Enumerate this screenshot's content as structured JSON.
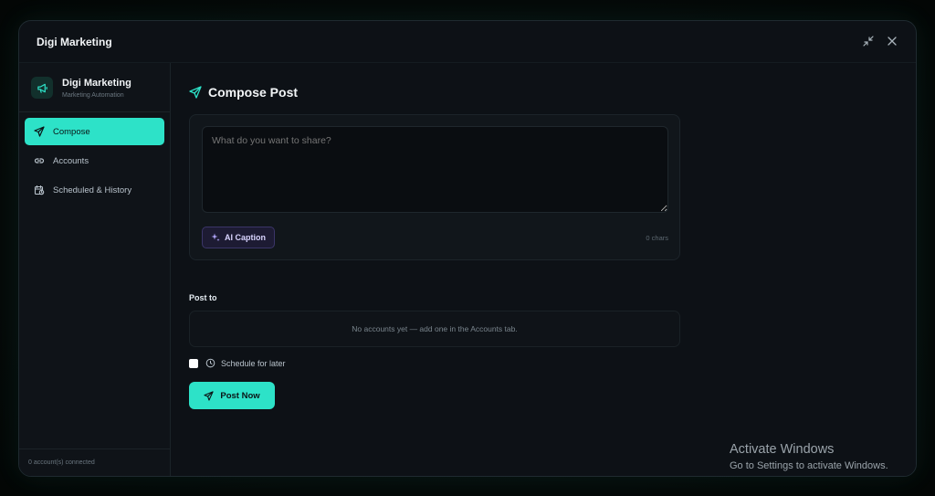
{
  "window": {
    "title": "Digi Marketing"
  },
  "brand": {
    "name": "Digi Marketing",
    "subtitle": "Marketing Automation",
    "icon": "megaphone-icon"
  },
  "sidebar": {
    "items": [
      {
        "label": "Compose",
        "icon": "send-icon",
        "active": true
      },
      {
        "label": "Accounts",
        "icon": "link-icon",
        "active": false
      },
      {
        "label": "Scheduled & History",
        "icon": "calendar-clock-icon",
        "active": false
      }
    ],
    "footer": "0 account(s) connected"
  },
  "main": {
    "title": "Compose Post",
    "compose": {
      "placeholder": "What do you want to share?",
      "value": "",
      "ai_caption_label": "AI Caption",
      "char_count": "0 chars"
    },
    "post_to": {
      "label": "Post to",
      "empty_message": "No accounts yet — add one in the Accounts tab."
    },
    "schedule": {
      "label": "Schedule for later",
      "checked": false
    },
    "post_button": "Post Now"
  },
  "overlay": {
    "activate_title": "Activate Windows",
    "activate_sub": "Go to Settings to activate Windows."
  },
  "colors": {
    "accent": "#2de2c8",
    "background": "#0d1116",
    "ai_button": "#1d1b33"
  }
}
